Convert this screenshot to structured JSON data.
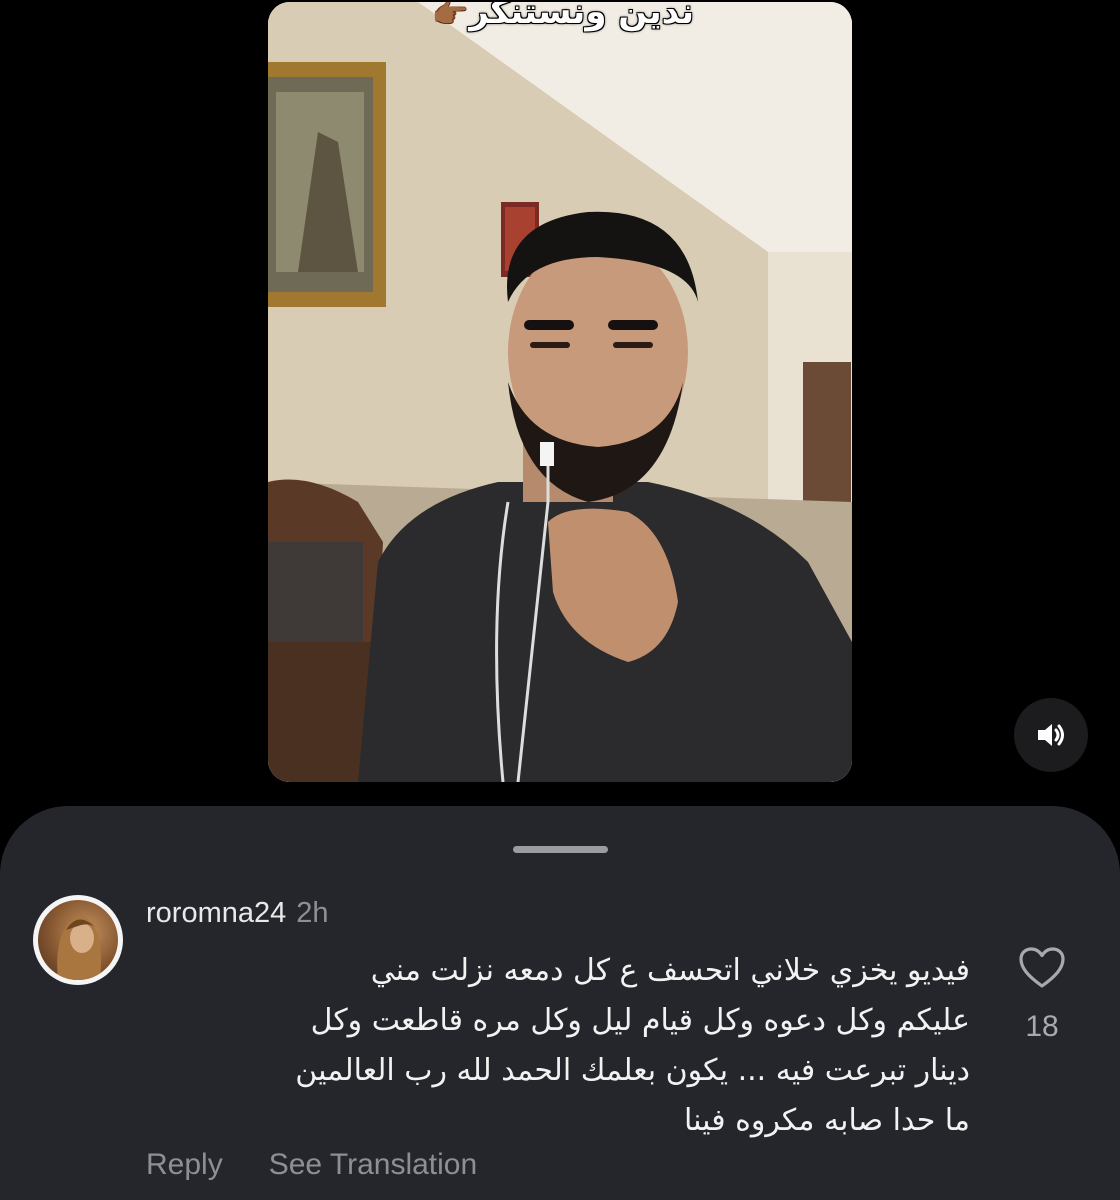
{
  "video": {
    "caption": "ندين ونستنكر",
    "caption_emoji": "👉🏾",
    "audio_icon": "speaker-icon"
  },
  "comment": {
    "username": "roromna24",
    "time": "2h",
    "lines": [
      "فيديو يخزي خلاني اتحسف ع كل دمعه نزلت مني",
      "عليكم وكل دعوه وكل قيام ليل وكل مره قاطعت وكل",
      "دينار تبرعت فيه ... يكون بعلمك الحمد لله رب العالمين",
      "ما حدا صابه مكروه فينا"
    ],
    "like_icon": "heart-icon",
    "like_count": "18",
    "reply_label": "Reply",
    "translate_label": "See Translation"
  },
  "colors": {
    "background": "#000000",
    "sheet": "#25262b",
    "primary_text": "#f2f2f2",
    "secondary_text": "#8e8f94"
  }
}
